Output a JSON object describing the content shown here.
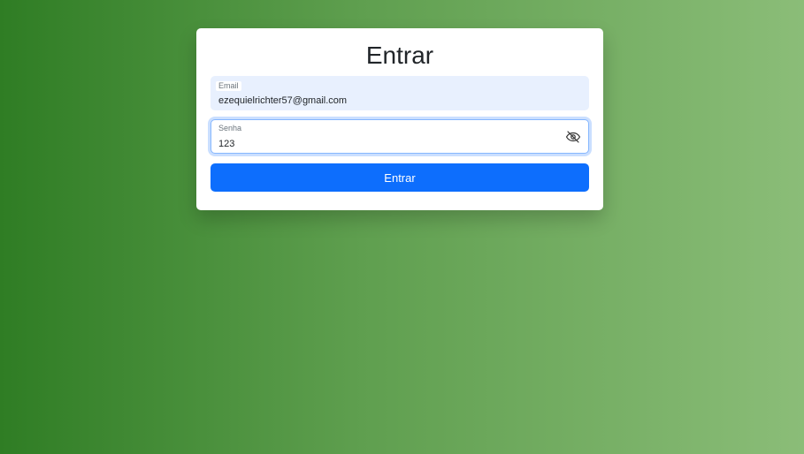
{
  "login": {
    "title": "Entrar",
    "email": {
      "label": "Email",
      "value": "ezequielrichter57@gmail.com"
    },
    "password": {
      "label": "Senha",
      "value": "123",
      "toggle_icon": "eye-off-icon"
    },
    "submit_label": "Entrar"
  },
  "colors": {
    "primary": "#0d6efd",
    "background_start": "#2f7d24",
    "background_end": "#8bbd78",
    "email_autofill_bg": "#e8f0fe"
  }
}
